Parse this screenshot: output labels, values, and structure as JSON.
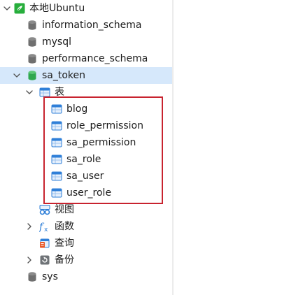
{
  "tree": {
    "connection": {
      "label": "本地Ubuntu",
      "icon": "connection-icon",
      "expanded": true
    },
    "databases": [
      {
        "label": "information_schema",
        "icon": "database-icon"
      },
      {
        "label": "mysql",
        "icon": "database-icon"
      },
      {
        "label": "performance_schema",
        "icon": "database-icon"
      },
      {
        "label": "sa_token",
        "icon": "database-icon",
        "expanded": true,
        "selected": true
      },
      {
        "label": "sys",
        "icon": "database-icon"
      }
    ],
    "sa_token_children": {
      "tables_group": {
        "label": "表",
        "icon": "table-icon",
        "expanded": true
      },
      "tables": [
        {
          "label": "blog",
          "icon": "table-icon"
        },
        {
          "label": "role_permission",
          "icon": "table-icon"
        },
        {
          "label": "sa_permission",
          "icon": "table-icon"
        },
        {
          "label": "sa_role",
          "icon": "table-icon"
        },
        {
          "label": "sa_user",
          "icon": "table-icon"
        },
        {
          "label": "user_role",
          "icon": "table-icon"
        }
      ],
      "views_group": {
        "label": "视图",
        "icon": "view-icon"
      },
      "functions_group": {
        "label": "函数",
        "icon": "function-icon",
        "collapsed": true
      },
      "queries_group": {
        "label": "查询",
        "icon": "query-icon"
      },
      "backups_group": {
        "label": "备份",
        "icon": "backup-icon",
        "collapsed": true
      }
    }
  },
  "colors": {
    "connection_green": "#27ae3c",
    "database_gray": "#6f6f6f",
    "database_active_green": "#2fa84f",
    "table_blue": "#2f7fd8",
    "selected_row": "#d6e8fb",
    "highlight_red": "#c8232f"
  }
}
